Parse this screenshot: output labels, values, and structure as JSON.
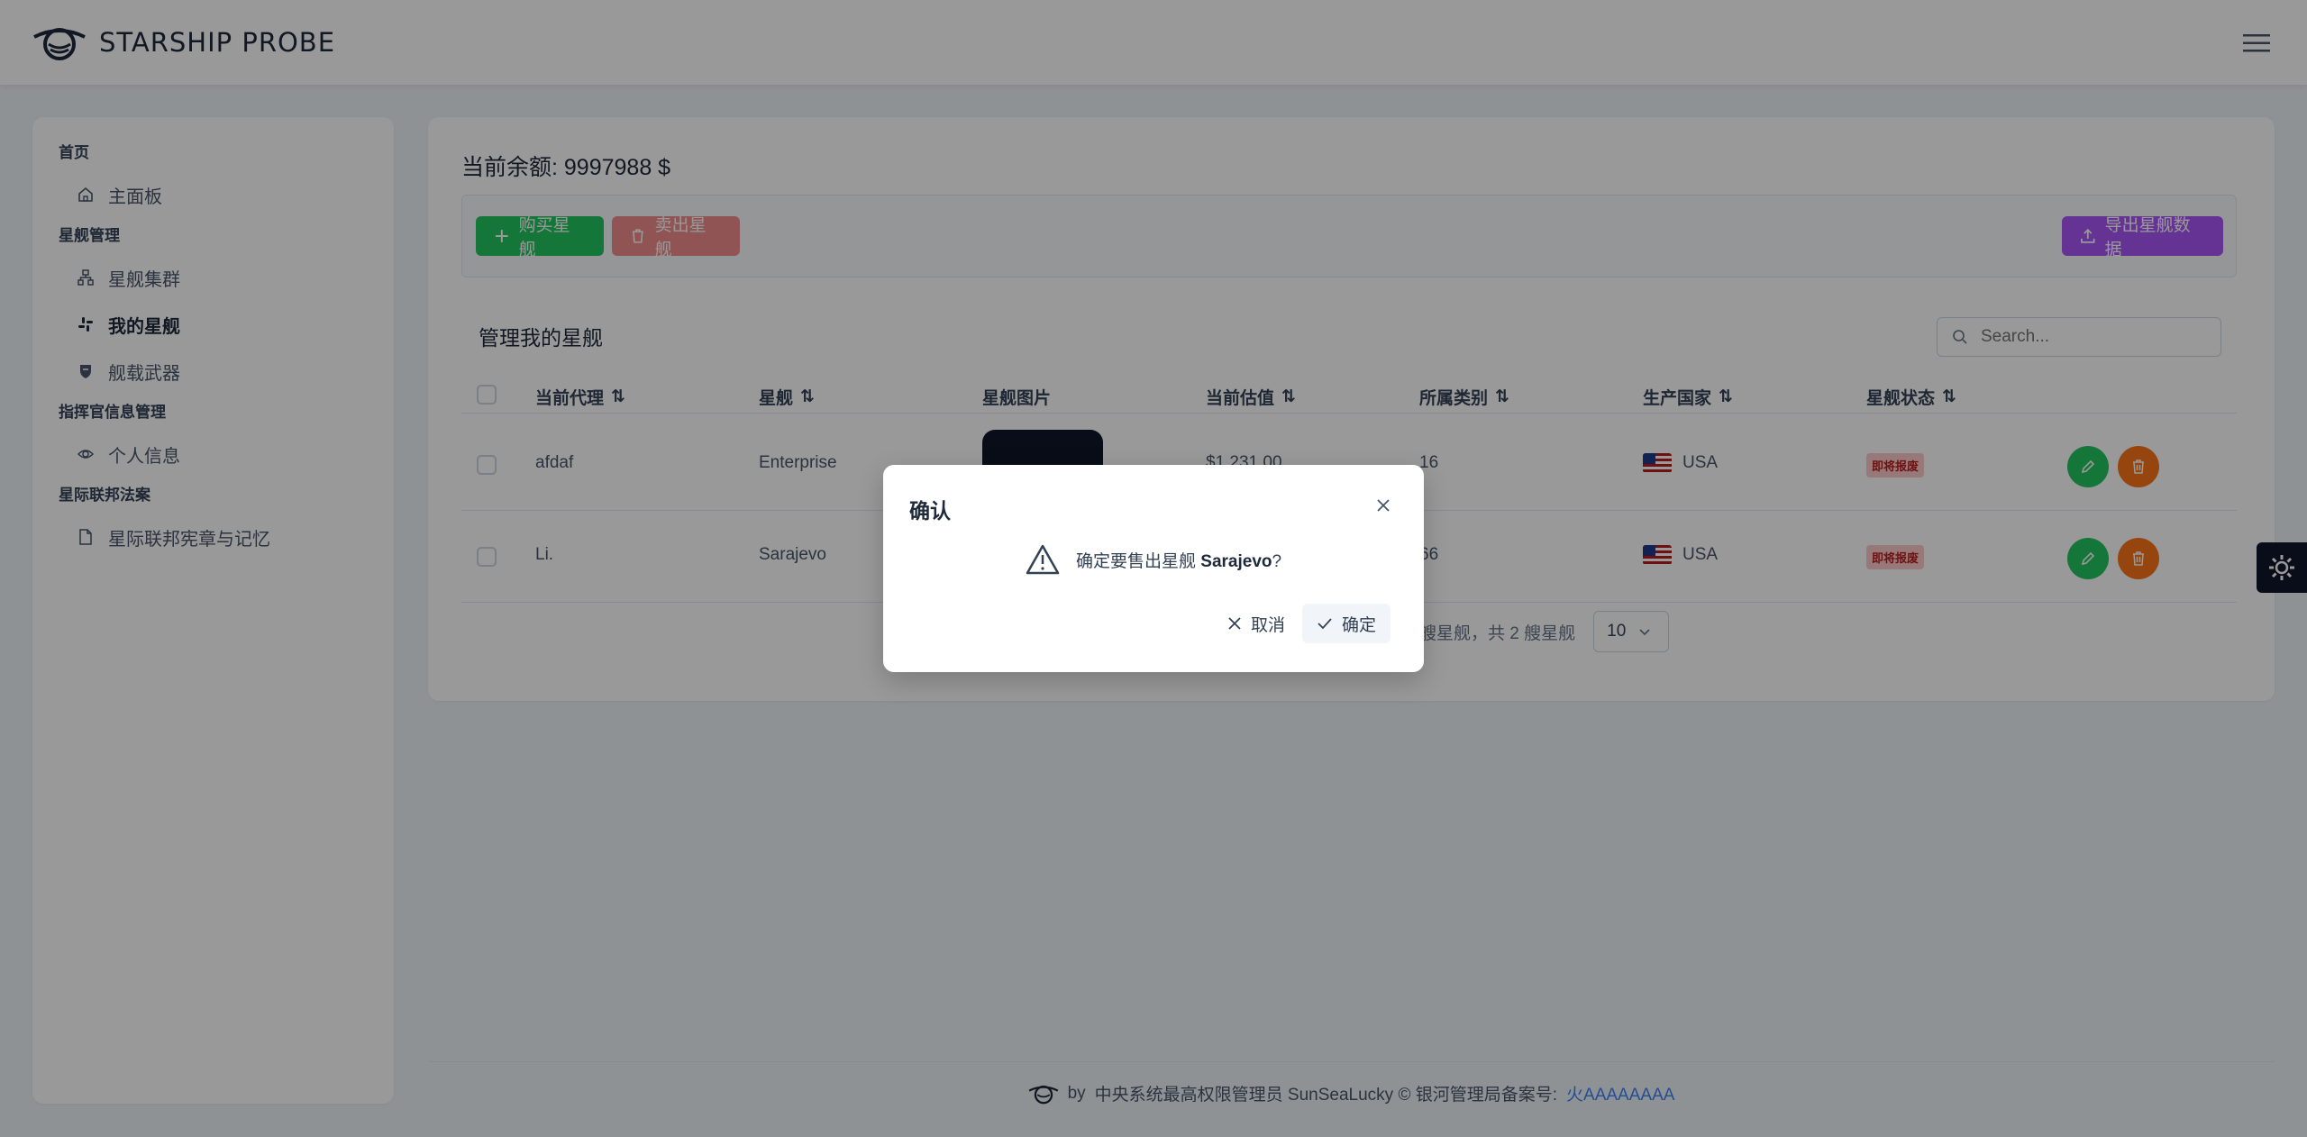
{
  "header": {
    "title": "STARSHIP PROBE"
  },
  "sidebar": {
    "sections": [
      {
        "title": "首页",
        "items": [
          {
            "label": "主面板",
            "icon": "home-icon"
          }
        ]
      },
      {
        "title": "星舰管理",
        "items": [
          {
            "label": "星舰集群",
            "icon": "sitemap-icon"
          },
          {
            "label": "我的星舰",
            "icon": "slack-icon",
            "active": true
          },
          {
            "label": "舰载武器",
            "icon": "shield-icon"
          }
        ]
      },
      {
        "title": "指挥官信息管理",
        "items": [
          {
            "label": "个人信息",
            "icon": "eye-icon"
          }
        ]
      },
      {
        "title": "星际联邦法案",
        "items": [
          {
            "label": "星际联邦宪章与记忆",
            "icon": "file-icon"
          }
        ]
      }
    ]
  },
  "main": {
    "balance_label": "当前余额:",
    "balance_value": "9997988 $",
    "toolbar": {
      "buy": "购买星舰",
      "sell": "卖出星舰",
      "export": "导出星舰数据"
    },
    "table_title": "管理我的星舰",
    "search_placeholder": "Search...",
    "columns": [
      "当前代理",
      "星舰",
      "星舰图片",
      "当前估值",
      "所属类别",
      "生产国家",
      "星舰状态"
    ],
    "rows": [
      {
        "agent": "afdaf",
        "ship": "Enterprise",
        "value": "$1,231.00",
        "category": "16",
        "country": "USA",
        "status": "即将报废"
      },
      {
        "agent": "Li.",
        "ship": "Sarajevo",
        "value": "",
        "category": "66",
        "country": "USA",
        "status": "即将报废"
      }
    ],
    "pager_text": "艘星舰，共 2 艘星舰",
    "page_size": "10"
  },
  "footer": {
    "by": "by",
    "text": "中央系统最高权限管理员 SunSeaLucky © 银河管理局备案号:",
    "link": "火AAAAAAAA"
  },
  "dialog": {
    "title": "确认",
    "message_prefix": "确定要售出星舰",
    "ship_name": "Sarajevo",
    "message_suffix": "?",
    "cancel": "取消",
    "confirm": "确定"
  },
  "colors": {
    "success": "#22c55e",
    "danger": "#ef4444",
    "help": "#a855f7",
    "warn": "#f97316"
  }
}
